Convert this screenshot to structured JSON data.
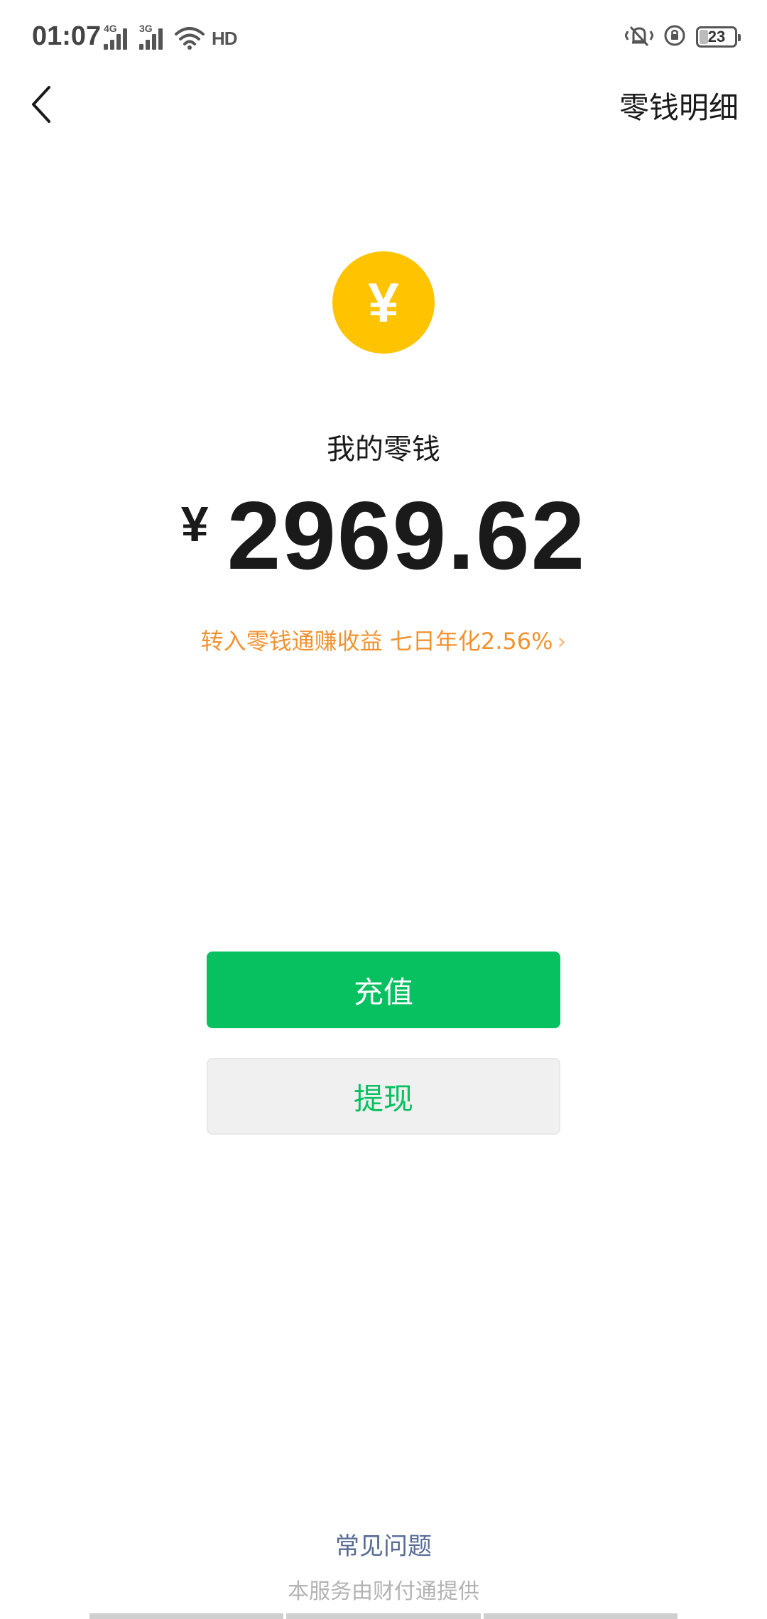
{
  "status_bar": {
    "time": "01:07",
    "signal1_tag": "4G",
    "signal2_tag": "3G",
    "hd_label": "HD",
    "battery_level": "23"
  },
  "nav": {
    "detail_link": "零钱明细"
  },
  "balance": {
    "coin_glyph": "¥",
    "label": "我的零钱",
    "currency": "¥",
    "amount": "2969.62"
  },
  "promo": {
    "text": "转入零钱通赚收益 七日年化2.56%",
    "chevron": "›"
  },
  "actions": {
    "recharge_label": "充值",
    "withdraw_label": "提现"
  },
  "footer": {
    "faq_label": "常见问题",
    "provider_note": "本服务由财付通提供"
  },
  "colors": {
    "coin": "#ffc300",
    "primary_green": "#07c160",
    "promo_orange": "#f29330",
    "link_blue": "#576b95"
  }
}
